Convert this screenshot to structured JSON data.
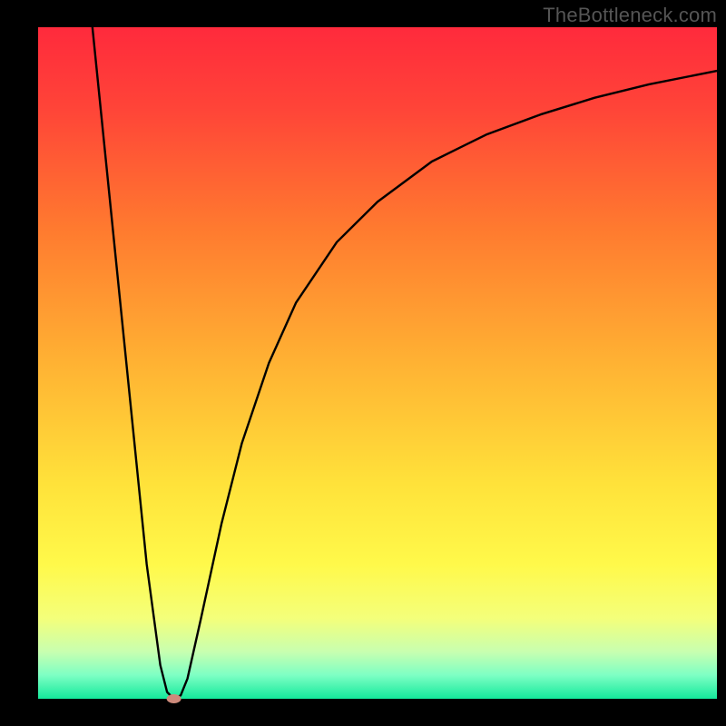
{
  "watermark": "TheBottleneck.com",
  "chart_data": {
    "type": "line",
    "title": "",
    "xlabel": "",
    "ylabel": "",
    "xlim": [
      0,
      100
    ],
    "ylim": [
      0,
      100
    ],
    "grid": false,
    "legend": false,
    "background_gradient": {
      "stops": [
        {
          "offset": 0.0,
          "color": "#ff2a3c"
        },
        {
          "offset": 0.12,
          "color": "#ff4438"
        },
        {
          "offset": 0.3,
          "color": "#ff7a2f"
        },
        {
          "offset": 0.5,
          "color": "#ffb233"
        },
        {
          "offset": 0.68,
          "color": "#ffe23a"
        },
        {
          "offset": 0.8,
          "color": "#fff94a"
        },
        {
          "offset": 0.88,
          "color": "#f4ff7a"
        },
        {
          "offset": 0.93,
          "color": "#c8ffb0"
        },
        {
          "offset": 0.965,
          "color": "#7dffc4"
        },
        {
          "offset": 1.0,
          "color": "#14e99b"
        }
      ]
    },
    "marker": {
      "x": 20,
      "y": 0,
      "color": "#cd8a7b",
      "rx": 8,
      "ry": 5
    },
    "series": [
      {
        "name": "curve",
        "points": [
          {
            "x": 8,
            "y": 100
          },
          {
            "x": 10,
            "y": 80
          },
          {
            "x": 12,
            "y": 60
          },
          {
            "x": 14,
            "y": 40
          },
          {
            "x": 16,
            "y": 20
          },
          {
            "x": 18,
            "y": 5
          },
          {
            "x": 19,
            "y": 1
          },
          {
            "x": 20,
            "y": 0
          },
          {
            "x": 21,
            "y": 0.5
          },
          {
            "x": 22,
            "y": 3
          },
          {
            "x": 24,
            "y": 12
          },
          {
            "x": 27,
            "y": 26
          },
          {
            "x": 30,
            "y": 38
          },
          {
            "x": 34,
            "y": 50
          },
          {
            "x": 38,
            "y": 59
          },
          {
            "x": 44,
            "y": 68
          },
          {
            "x": 50,
            "y": 74
          },
          {
            "x": 58,
            "y": 80
          },
          {
            "x": 66,
            "y": 84
          },
          {
            "x": 74,
            "y": 87
          },
          {
            "x": 82,
            "y": 89.5
          },
          {
            "x": 90,
            "y": 91.5
          },
          {
            "x": 100,
            "y": 93.5
          }
        ]
      }
    ]
  }
}
